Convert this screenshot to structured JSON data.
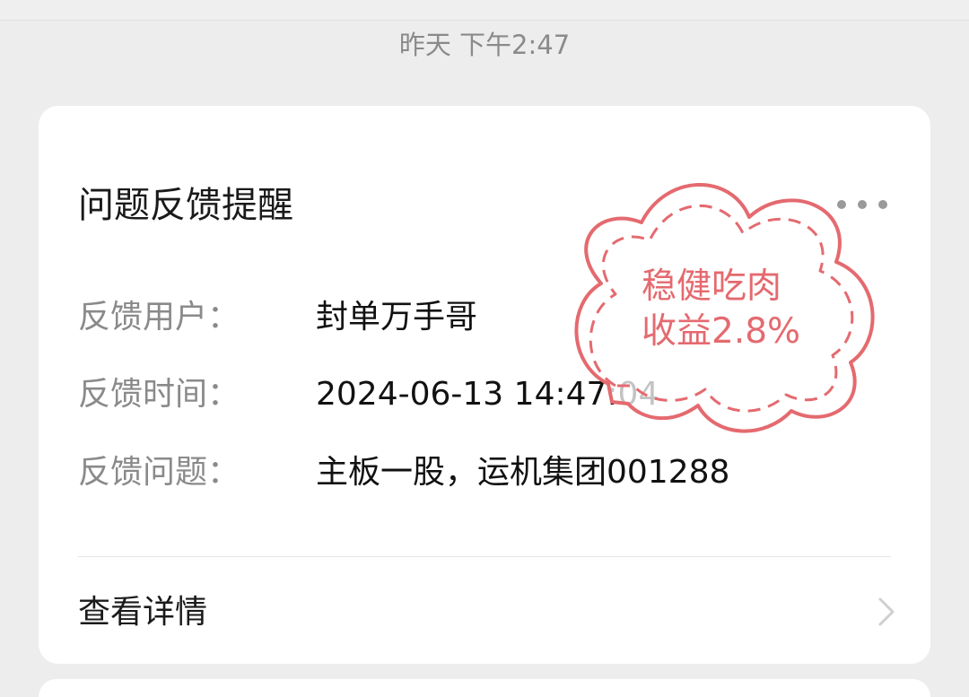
{
  "timestamp": "昨天 下午2:47",
  "card": {
    "title": "问题反馈提醒",
    "rows": [
      {
        "label": "反馈用户：",
        "value": "封单万手哥"
      },
      {
        "label": "反馈时间：",
        "value": "2024-06-13 14:47:04"
      },
      {
        "label": "反馈问题：",
        "value": "主板一股，运机集团001288"
      }
    ],
    "detail_label": "查看详情"
  },
  "stamp": {
    "line1": "稳健吃肉",
    "line2": "收益2.8%",
    "color": "#e46a6f"
  },
  "icons": {
    "more": "more-dots-icon",
    "chevron": "chevron-right-icon"
  }
}
